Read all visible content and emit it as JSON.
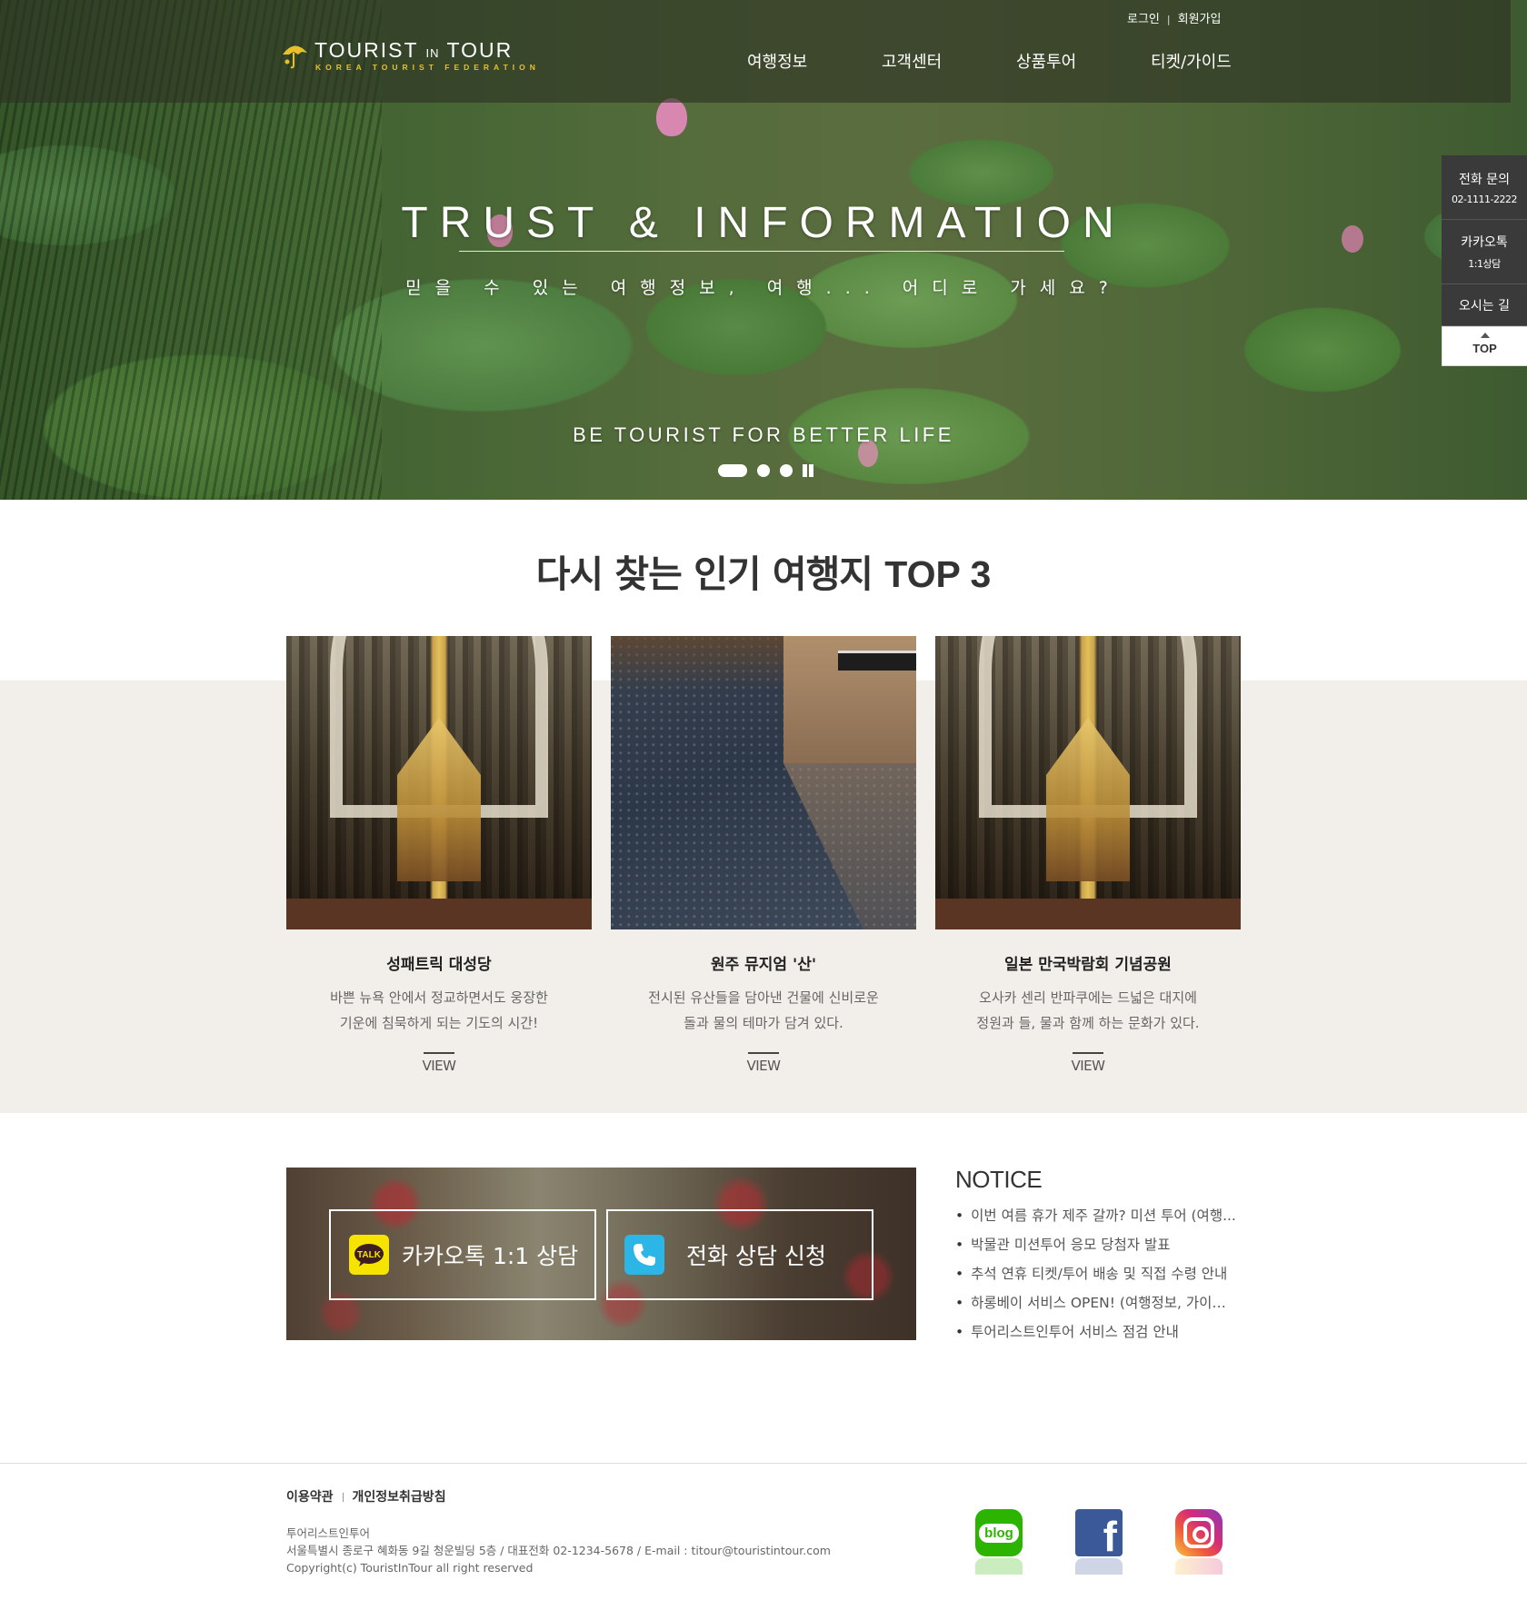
{
  "header": {
    "logo_text_1": "TOURIST",
    "logo_text_in": "IN",
    "logo_text_2": "TOUR",
    "logo_sub": "KOREA TOURIST FEDERATION",
    "util": {
      "login": "로그인",
      "separator": "|",
      "join": "회원가입"
    },
    "nav": [
      "여행정보",
      "고객센터",
      "상품투어",
      "티켓/가이드"
    ]
  },
  "hero": {
    "title": "TRUST & INFORMATION",
    "subtitle": "믿을 수 있는 여행정보, 여행... 어디로 가세요?",
    "slogan": "BE TOURIST FOR BETTER LIFE",
    "slides": 3,
    "active_slide": 1
  },
  "quick_menu": {
    "phone": {
      "label": "전화 문의",
      "value": "02-1111-2222"
    },
    "kakao": {
      "label": "카카오톡",
      "value": "1:1상담"
    },
    "map": {
      "label": "오시는 길"
    },
    "top": {
      "label": "TOP"
    }
  },
  "top3": {
    "title_light": "다시 찾는 인기 여행지",
    "title_bold": "TOP 3",
    "items": [
      {
        "name": "성패트릭 대성당",
        "desc_1": "바쁜 뉴욕 안에서 정교하면서도 웅장한",
        "desc_2": "기운에 침묵하게 되는 기도의 시간!",
        "link": "VIEW"
      },
      {
        "name": "원주 뮤지엄 '산'",
        "desc_1": "전시된 유산들을 담아낸 건물에 신비로운",
        "desc_2": "돌과 물의 테마가 담겨 있다.",
        "link": "VIEW"
      },
      {
        "name": "일본 만국박람회 기념공원",
        "desc_1": "오사카 센리 반파쿠에는 드넓은 대지에",
        "desc_2": "정원과 들, 물과 함께 하는 문화가 있다.",
        "link": "VIEW"
      }
    ]
  },
  "consult": {
    "kakao_icon_text": "TALK",
    "kakao_label": "카카오톡 1:1 상담",
    "phone_label": "전화 상담 신청"
  },
  "notice": {
    "title": "NOTICE",
    "items": [
      "이번 여름 휴가 제주 갈까? 미션 투어 (여행...",
      "박물관 미션투어 응모 당첨자 발표",
      "추석 연휴 티켓/투어 배송 및 직접 수령 안내",
      "하롱베이 서비스 OPEN! (여행정보, 가이드...",
      "투어리스트인투어 서비스 점검 안내"
    ]
  },
  "footer": {
    "terms": "이용약관",
    "privacy": "개인정보취급방침",
    "company": "투어리스트인투어",
    "address": "서울특별시 종로구 혜화동 9길 청운빌딩 5층 / 대표전화 02-1234-5678 / E-mail : titour@touristintour.com",
    "copyright": "Copyright(c) TouristInTour all right reserved",
    "sns": {
      "blog_text": "blog",
      "facebook_text": "f"
    }
  },
  "colors": {
    "logo_yellow": "#e8c02a",
    "beige_band": "#f2efea",
    "kakao_yellow": "#f7e300",
    "phone_blue": "#2bb6e7",
    "quick_menu_bg": "#3a3a3a"
  }
}
